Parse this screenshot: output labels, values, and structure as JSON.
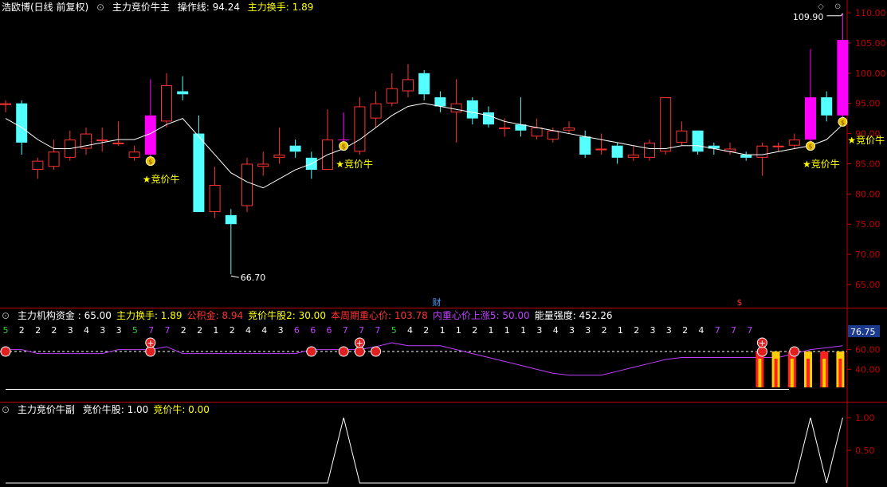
{
  "colors": {
    "up": "#ff3232",
    "down": "#54ffff",
    "auction": "#ff00ff",
    "ma": "#ffffff",
    "axis": "#c00000",
    "label_yellow": "#ffff00",
    "label_white": "#ffffff",
    "purple": "#c040ff",
    "green": "#33cc33"
  },
  "main_panel": {
    "stock_name": "浩欧博(日线 前复权)",
    "indicator_name": "主力竞价牛主",
    "op_line_label": "操作线: 94.24",
    "turnover_label": "主力换手: 1.89",
    "high_label": "109.90",
    "low_label": "66.70",
    "signal_text": "★竞价牛",
    "fin_marker": "财",
    "dollar_marker": "$",
    "icons": [
      "money-bag-icon",
      "settings-icon",
      "restore-icon",
      "close-icon"
    ]
  },
  "sub_panel_1": {
    "indicator_name": "主力机构资金",
    "values": [
      {
        "text": ": 65.00",
        "color": "#ffffff"
      },
      {
        "text": "主力换手: 1.89",
        "color": "#ffff00"
      },
      {
        "text": "公积金: 8.94",
        "color": "#ff3232"
      },
      {
        "text": "竞价牛股2: 30.00",
        "color": "#ffff00"
      },
      {
        "text": "本周期重心价: 103.78",
        "color": "#ff3232"
      },
      {
        "text": "内重心价上涨5: 50.00",
        "color": "#c040ff"
      },
      {
        "text": "能量强度: 452.26",
        "color": "#ffffff"
      }
    ],
    "digits": [
      "5",
      "2",
      "2",
      "2",
      "3",
      "4",
      "3",
      "3",
      "5",
      "7",
      "7",
      "2",
      "2",
      "1",
      "2",
      "4",
      "4",
      "3",
      "6",
      "6",
      "6",
      "7",
      "7",
      "7",
      "5",
      "4",
      "2",
      "1",
      "1",
      "2",
      "1",
      "1",
      "1",
      "3",
      "4",
      "3",
      "3",
      "2",
      "1",
      "2",
      "3",
      "3",
      "2",
      "4",
      "7",
      "7",
      "7"
    ],
    "current_value": "76.75",
    "axis_labels": [
      "60.00",
      "40.00"
    ]
  },
  "sub_panel_2": {
    "indicator_name": "主力竞价牛副",
    "values": [
      {
        "text": "竞价牛股: 1.00",
        "color": "#ffffff"
      },
      {
        "text": "竞价牛: 0.00",
        "color": "#ffff00"
      }
    ],
    "axis_labels": [
      "1.00",
      "0.50"
    ]
  },
  "chart_data": [
    {
      "type": "candlestick",
      "y_axis_ticks": [
        "110.00",
        "105.00",
        "100.00",
        "95.00",
        "90.00",
        "85.00",
        "80.00",
        "75.00",
        "70.00",
        "65.00"
      ],
      "ylim": [
        62,
        112
      ],
      "candles": [
        {
          "o": 95.0,
          "c": 95.0,
          "h": 95.5,
          "l": 93.5
        },
        {
          "o": 95.0,
          "c": 88.5,
          "h": 95.5,
          "l": 86.5
        },
        {
          "o": 84.0,
          "c": 85.5,
          "h": 86.0,
          "l": 82.5
        },
        {
          "o": 84.5,
          "c": 87.0,
          "h": 89.0,
          "l": 84.0
        },
        {
          "o": 86.0,
          "c": 89.0,
          "h": 90.5,
          "l": 85.5
        },
        {
          "o": 87.5,
          "c": 90.0,
          "h": 91.0,
          "l": 86.5
        },
        {
          "o": 89.0,
          "c": 89.0,
          "h": 91.0,
          "l": 87.0
        },
        {
          "o": 88.5,
          "c": 88.5,
          "h": 92.0,
          "l": 88.0
        },
        {
          "o": 86.0,
          "c": 87.0,
          "h": 88.0,
          "l": 85.5
        },
        {
          "o": 86.5,
          "c": 93.0,
          "h": 99.0,
          "l": 85.0
        },
        {
          "o": 92.0,
          "c": 98.0,
          "h": 100.0,
          "l": 91.0
        },
        {
          "o": 97.0,
          "c": 96.5,
          "h": 99.5,
          "l": 95.5
        },
        {
          "o": 90.0,
          "c": 77.0,
          "h": 93.0,
          "l": 77.0
        },
        {
          "o": 77.0,
          "c": 81.5,
          "h": 84.5,
          "l": 76.0
        },
        {
          "o": 76.5,
          "c": 75.0,
          "h": 77.5,
          "l": 66.7
        },
        {
          "o": 78.0,
          "c": 85.0,
          "h": 86.0,
          "l": 77.0
        },
        {
          "o": 84.5,
          "c": 85.0,
          "h": 87.0,
          "l": 83.0
        },
        {
          "o": 86.0,
          "c": 86.5,
          "h": 91.0,
          "l": 85.0
        },
        {
          "o": 88.0,
          "c": 87.0,
          "h": 89.0,
          "l": 86.0
        },
        {
          "o": 86.0,
          "c": 84.0,
          "h": 87.0,
          "l": 82.5
        },
        {
          "o": 84.0,
          "c": 89.0,
          "h": 94.0,
          "l": 84.0
        },
        {
          "o": 89.0,
          "c": 89.0,
          "h": 93.5,
          "l": 88.0
        },
        {
          "o": 87.0,
          "c": 94.5,
          "h": 96.0,
          "l": 86.5
        },
        {
          "o": 92.5,
          "c": 95.0,
          "h": 97.0,
          "l": 91.0
        },
        {
          "o": 95.0,
          "c": 97.5,
          "h": 100.0,
          "l": 94.5
        },
        {
          "o": 97.0,
          "c": 99.0,
          "h": 101.5,
          "l": 96.0
        },
        {
          "o": 100.0,
          "c": 96.5,
          "h": 100.5,
          "l": 95.5
        },
        {
          "o": 96.0,
          "c": 94.5,
          "h": 97.0,
          "l": 93.5
        },
        {
          "o": 93.5,
          "c": 95.0,
          "h": 99.0,
          "l": 88.5
        },
        {
          "o": 95.5,
          "c": 92.5,
          "h": 96.0,
          "l": 91.5
        },
        {
          "o": 93.5,
          "c": 91.5,
          "h": 94.5,
          "l": 91.0
        },
        {
          "o": 91.0,
          "c": 91.0,
          "h": 92.5,
          "l": 89.5
        },
        {
          "o": 91.5,
          "c": 90.5,
          "h": 96.0,
          "l": 89.5
        },
        {
          "o": 89.5,
          "c": 91.0,
          "h": 92.5,
          "l": 89.0
        },
        {
          "o": 89.0,
          "c": 90.5,
          "h": 91.0,
          "l": 88.5
        },
        {
          "o": 90.5,
          "c": 91.0,
          "h": 92.0,
          "l": 90.0
        },
        {
          "o": 89.5,
          "c": 86.5,
          "h": 90.5,
          "l": 86.0
        },
        {
          "o": 87.5,
          "c": 87.5,
          "h": 90.0,
          "l": 86.5
        },
        {
          "o": 88.0,
          "c": 86.0,
          "h": 88.5,
          "l": 85.0
        },
        {
          "o": 86.0,
          "c": 86.5,
          "h": 88.0,
          "l": 85.5
        },
        {
          "o": 86.0,
          "c": 88.5,
          "h": 89.0,
          "l": 85.5
        },
        {
          "o": 87.0,
          "c": 96.0,
          "h": 96.0,
          "l": 86.5
        },
        {
          "o": 88.5,
          "c": 90.5,
          "h": 92.0,
          "l": 88.0
        },
        {
          "o": 90.5,
          "c": 87.0,
          "h": 90.5,
          "l": 86.5
        },
        {
          "o": 88.0,
          "c": 87.5,
          "h": 88.5,
          "l": 86.5
        },
        {
          "o": 87.0,
          "c": 87.5,
          "h": 88.5,
          "l": 86.5
        },
        {
          "o": 86.5,
          "c": 86.0,
          "h": 87.0,
          "l": 85.5
        },
        {
          "o": 86.0,
          "c": 88.0,
          "h": 88.5,
          "l": 83.0
        },
        {
          "o": 88.0,
          "c": 88.0,
          "h": 88.5,
          "l": 87.0
        },
        {
          "o": 88.0,
          "c": 89.0,
          "h": 90.0,
          "l": 87.5
        },
        {
          "o": 89.0,
          "c": 96.0,
          "h": 104.0,
          "l": 88.5
        },
        {
          "o": 96.0,
          "c": 93.0,
          "h": 97.0,
          "l": 92.0
        },
        {
          "o": 93.0,
          "c": 105.5,
          "h": 109.9,
          "l": 92.5
        }
      ],
      "auction_candles": [
        9,
        21,
        50,
        52
      ],
      "signal_candles": [
        9,
        21,
        50,
        52
      ],
      "ma": [
        92.5,
        91.0,
        89.0,
        87.5,
        87.5,
        88.0,
        88.5,
        89.0,
        89.0,
        90.0,
        91.5,
        92.5,
        89.5,
        86.5,
        83.5,
        82.0,
        81.0,
        82.5,
        84.0,
        85.0,
        86.5,
        87.5,
        89.0,
        91.0,
        93.0,
        94.5,
        95.0,
        94.5,
        94.0,
        93.5,
        93.0,
        92.0,
        91.5,
        91.0,
        90.5,
        90.0,
        89.5,
        89.0,
        88.5,
        88.0,
        87.5,
        87.5,
        88.0,
        88.0,
        87.5,
        87.0,
        86.5,
        86.5,
        87.0,
        87.5,
        88.0,
        89.0,
        91.5
      ]
    },
    {
      "type": "line",
      "name": "主力机构资金",
      "ylim": [
        20,
        80
      ],
      "values": [
        60,
        60,
        56,
        56,
        56,
        56,
        56,
        60,
        60,
        60,
        63,
        56,
        56,
        56,
        56,
        56,
        56,
        56,
        56,
        60,
        60,
        60,
        60,
        63,
        67,
        64,
        64,
        64,
        60,
        56,
        52,
        48,
        44,
        40,
        36,
        34,
        34,
        34,
        38,
        42,
        46,
        50,
        52,
        52,
        52,
        52,
        52,
        52,
        52,
        56,
        60,
        62,
        64
      ]
    },
    {
      "type": "line",
      "name": "竞价牛股",
      "ylim": [
        0,
        1.2
      ],
      "values": [
        0,
        0,
        0,
        0,
        0,
        0,
        0,
        0,
        0,
        0,
        0,
        0,
        0,
        0,
        0,
        0,
        0,
        0,
        0,
        0,
        0,
        1,
        0,
        0,
        0,
        0,
        0,
        0,
        0,
        0,
        0,
        0,
        0,
        0,
        0,
        0,
        0,
        0,
        0,
        0,
        0,
        0,
        0,
        0,
        0,
        0,
        0,
        0,
        0,
        0,
        1,
        0,
        1
      ]
    }
  ]
}
